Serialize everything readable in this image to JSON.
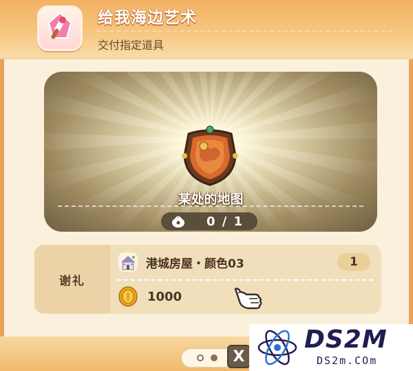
{
  "quest": {
    "title": "给我海边艺术",
    "subtitle": "交付指定道具",
    "icon": "paintbrush-icon"
  },
  "required_item": {
    "name": "某处的地图",
    "icon": "treasure-map-icon",
    "progress_text": "0 / 1",
    "progress_icon": "bag-icon",
    "collected": 0,
    "required": 1
  },
  "rewards": {
    "label": "谢礼",
    "items": [
      {
        "icon": "house-icon",
        "name": "港城房屋・颜色03",
        "quantity": "1"
      },
      {
        "icon": "gold-coin-icon",
        "amount": "1000"
      }
    ]
  },
  "pager": {
    "pages": 2,
    "current": 1
  },
  "close_label": "X",
  "watermark": {
    "main": "DS2M",
    "sub": "DS2m.COm"
  },
  "colors": {
    "header": "#f3b163",
    "panel": "#fbf0dc",
    "reward_box": "#f1dfbc",
    "title_outline": "#c5743a"
  }
}
